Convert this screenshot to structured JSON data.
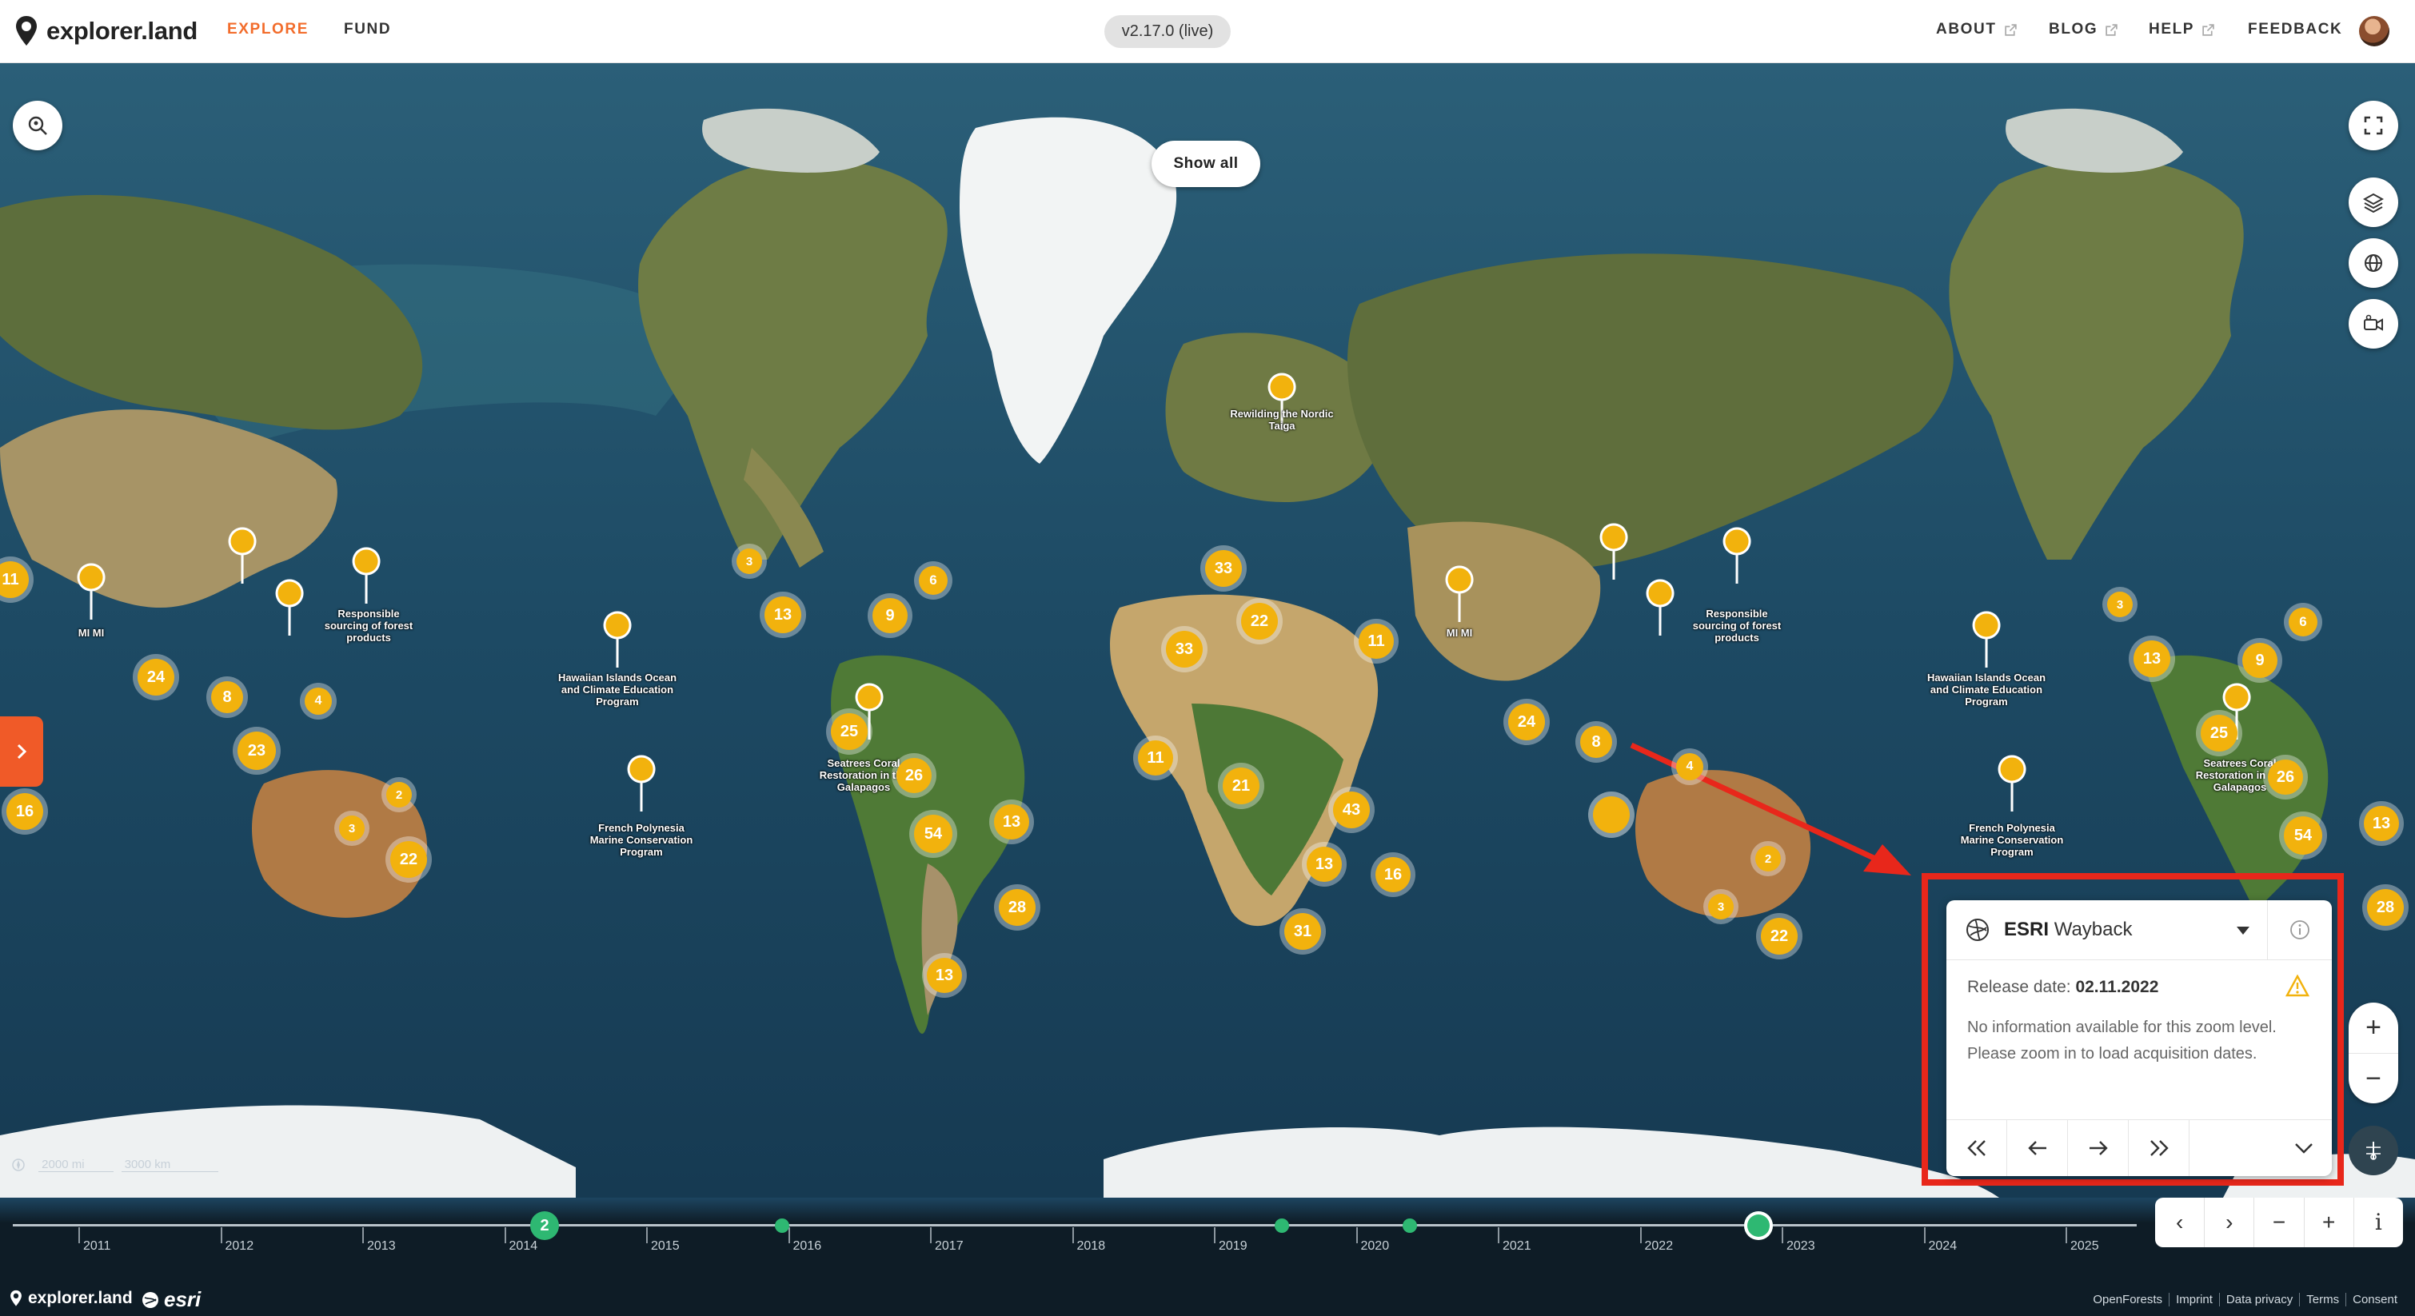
{
  "header": {
    "logo_text": "explorer.land",
    "nav": [
      {
        "label": "EXPLORE",
        "active": true
      },
      {
        "label": "FUND",
        "active": false
      }
    ],
    "version": "v2.17.0 (live)",
    "right_nav": [
      {
        "label": "ABOUT"
      },
      {
        "label": "BLOG"
      },
      {
        "label": "HELP"
      }
    ],
    "feedback": "FEEDBACK"
  },
  "map": {
    "show_all": "Show all",
    "scale": {
      "left": "2000 mi",
      "right": "3000 km"
    },
    "clusters": [
      "11",
      "24",
      "8",
      "4",
      "23",
      "16",
      "2",
      "3",
      "22",
      "3",
      "13",
      "6",
      "9",
      "25",
      "26",
      "54",
      "13",
      "28",
      "13",
      "33",
      "22",
      "33",
      "11",
      "11",
      "21",
      "43",
      "13",
      "16",
      "31",
      "24",
      "8",
      "4",
      "2",
      "3",
      "22",
      "3",
      "13",
      "6",
      "9",
      "25",
      "26",
      "54",
      "13",
      "28"
    ],
    "pin_labels": {
      "mimi": "MI MI",
      "forest": "Responsible sourcing of forest products",
      "hawaii": "Hawaiian Islands Ocean and Climate Education Program",
      "polynesia": "French Polynesia Marine Conservation Program",
      "seatrees": "Seatrees Coral Restoration in the Galapagos",
      "taiga": "Rewilding the Nordic Taiga"
    }
  },
  "esri_panel": {
    "brand": "ESRI",
    "title": "Wayback",
    "release_label": "Release date:",
    "release_date": "02.11.2022",
    "info": "No information available for this zoom level. Please zoom in to load acquisition dates."
  },
  "zoom": {
    "in": "+",
    "out": "−"
  },
  "timeline": {
    "years": [
      "2011",
      "2012",
      "2013",
      "2014",
      "2015",
      "2016",
      "2017",
      "2018",
      "2019",
      "2020",
      "2021",
      "2022",
      "2023",
      "2024",
      "2025"
    ],
    "marker_count": "2",
    "controls": [
      "‹",
      "›",
      "−",
      "+",
      "i"
    ]
  },
  "footer": {
    "logo_text": "explorer.land",
    "esri": "esri",
    "links": [
      "OpenForests",
      "Imprint",
      "Data privacy",
      "Terms",
      "Consent"
    ]
  },
  "colors": {
    "accent": "#f26c2b",
    "cluster": "#f2b20d",
    "highlight": "#e8271b",
    "timeline_dot": "#2eb872"
  }
}
